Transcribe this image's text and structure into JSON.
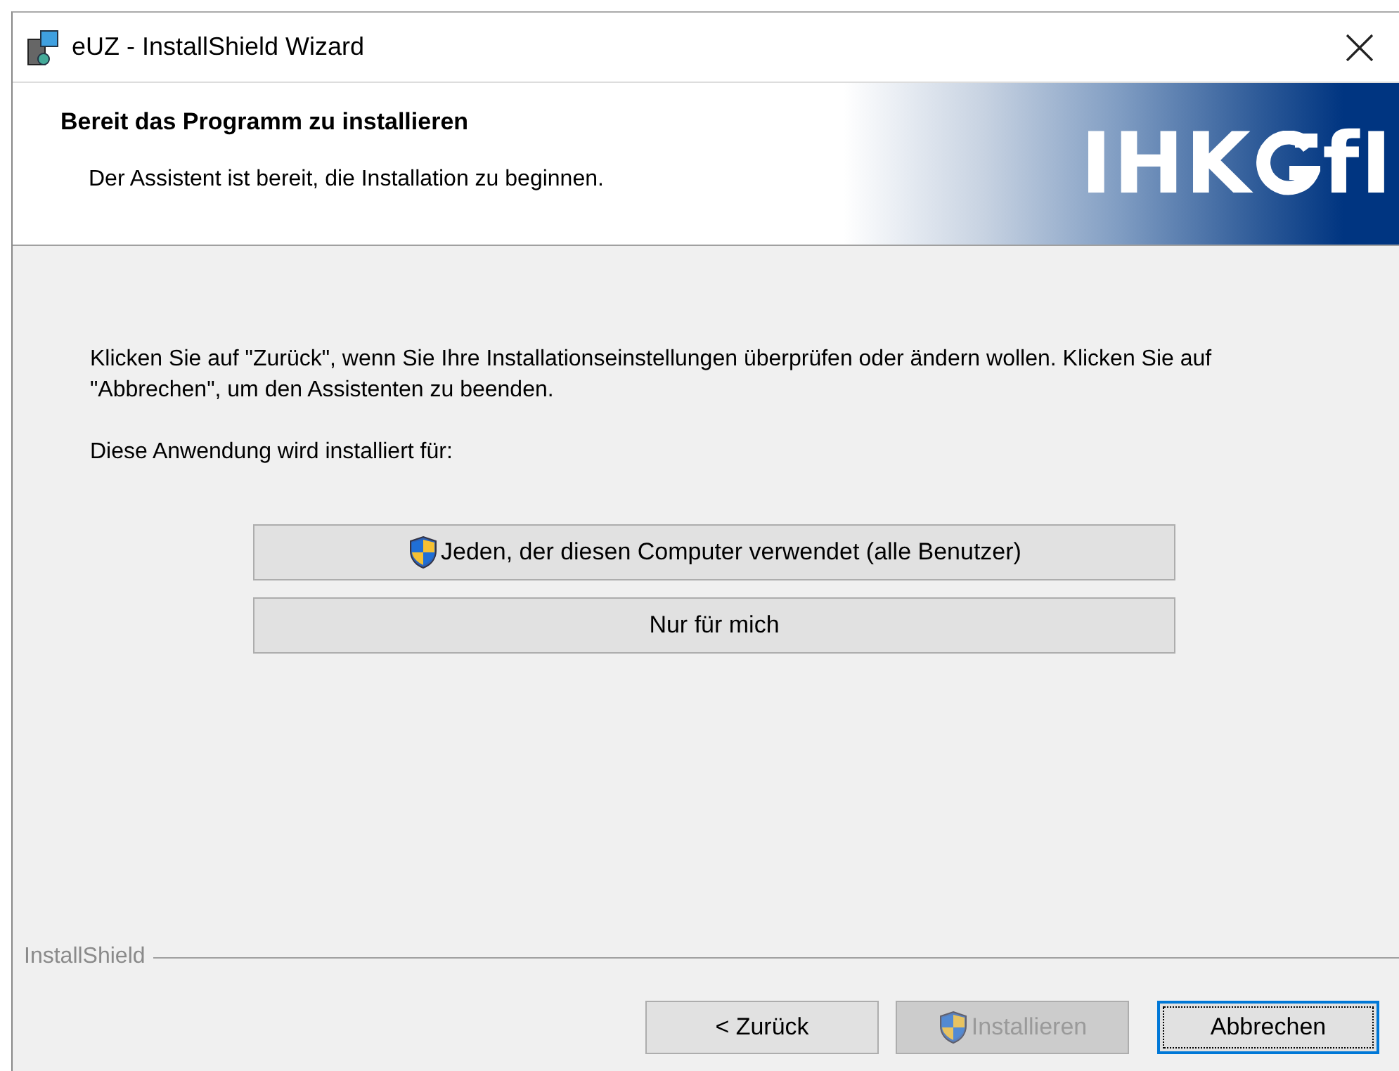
{
  "window": {
    "title": "eUZ - InstallShield Wizard"
  },
  "header": {
    "title": "Bereit das Programm zu installieren",
    "subtitle": "Der Assistent ist bereit, die Installation zu beginnen.",
    "logo": {
      "left": "IHK",
      "right": "fI"
    }
  },
  "body": {
    "paragraphs": [
      "Klicken Sie auf \"Zurück\", wenn Sie Ihre Installationseinstellungen überprüfen oder ändern wollen. Klicken Sie auf \"Abbrechen\", um den Assistenten zu beenden.",
      "Diese Anwendung wird installiert für:"
    ],
    "choices": [
      {
        "label": "Jeden, der diesen Computer verwendet (alle Benutzer)",
        "shield": true
      },
      {
        "label": "Nur für mich",
        "shield": false
      }
    ]
  },
  "footer": {
    "brand": "InstallShield",
    "buttons": [
      {
        "label": "< Zurück",
        "shield": false,
        "disabled": false,
        "default": false
      },
      {
        "label": "Installieren",
        "shield": true,
        "disabled": true,
        "default": false
      },
      {
        "label": "Abbrechen",
        "shield": false,
        "disabled": false,
        "default": true
      }
    ]
  }
}
